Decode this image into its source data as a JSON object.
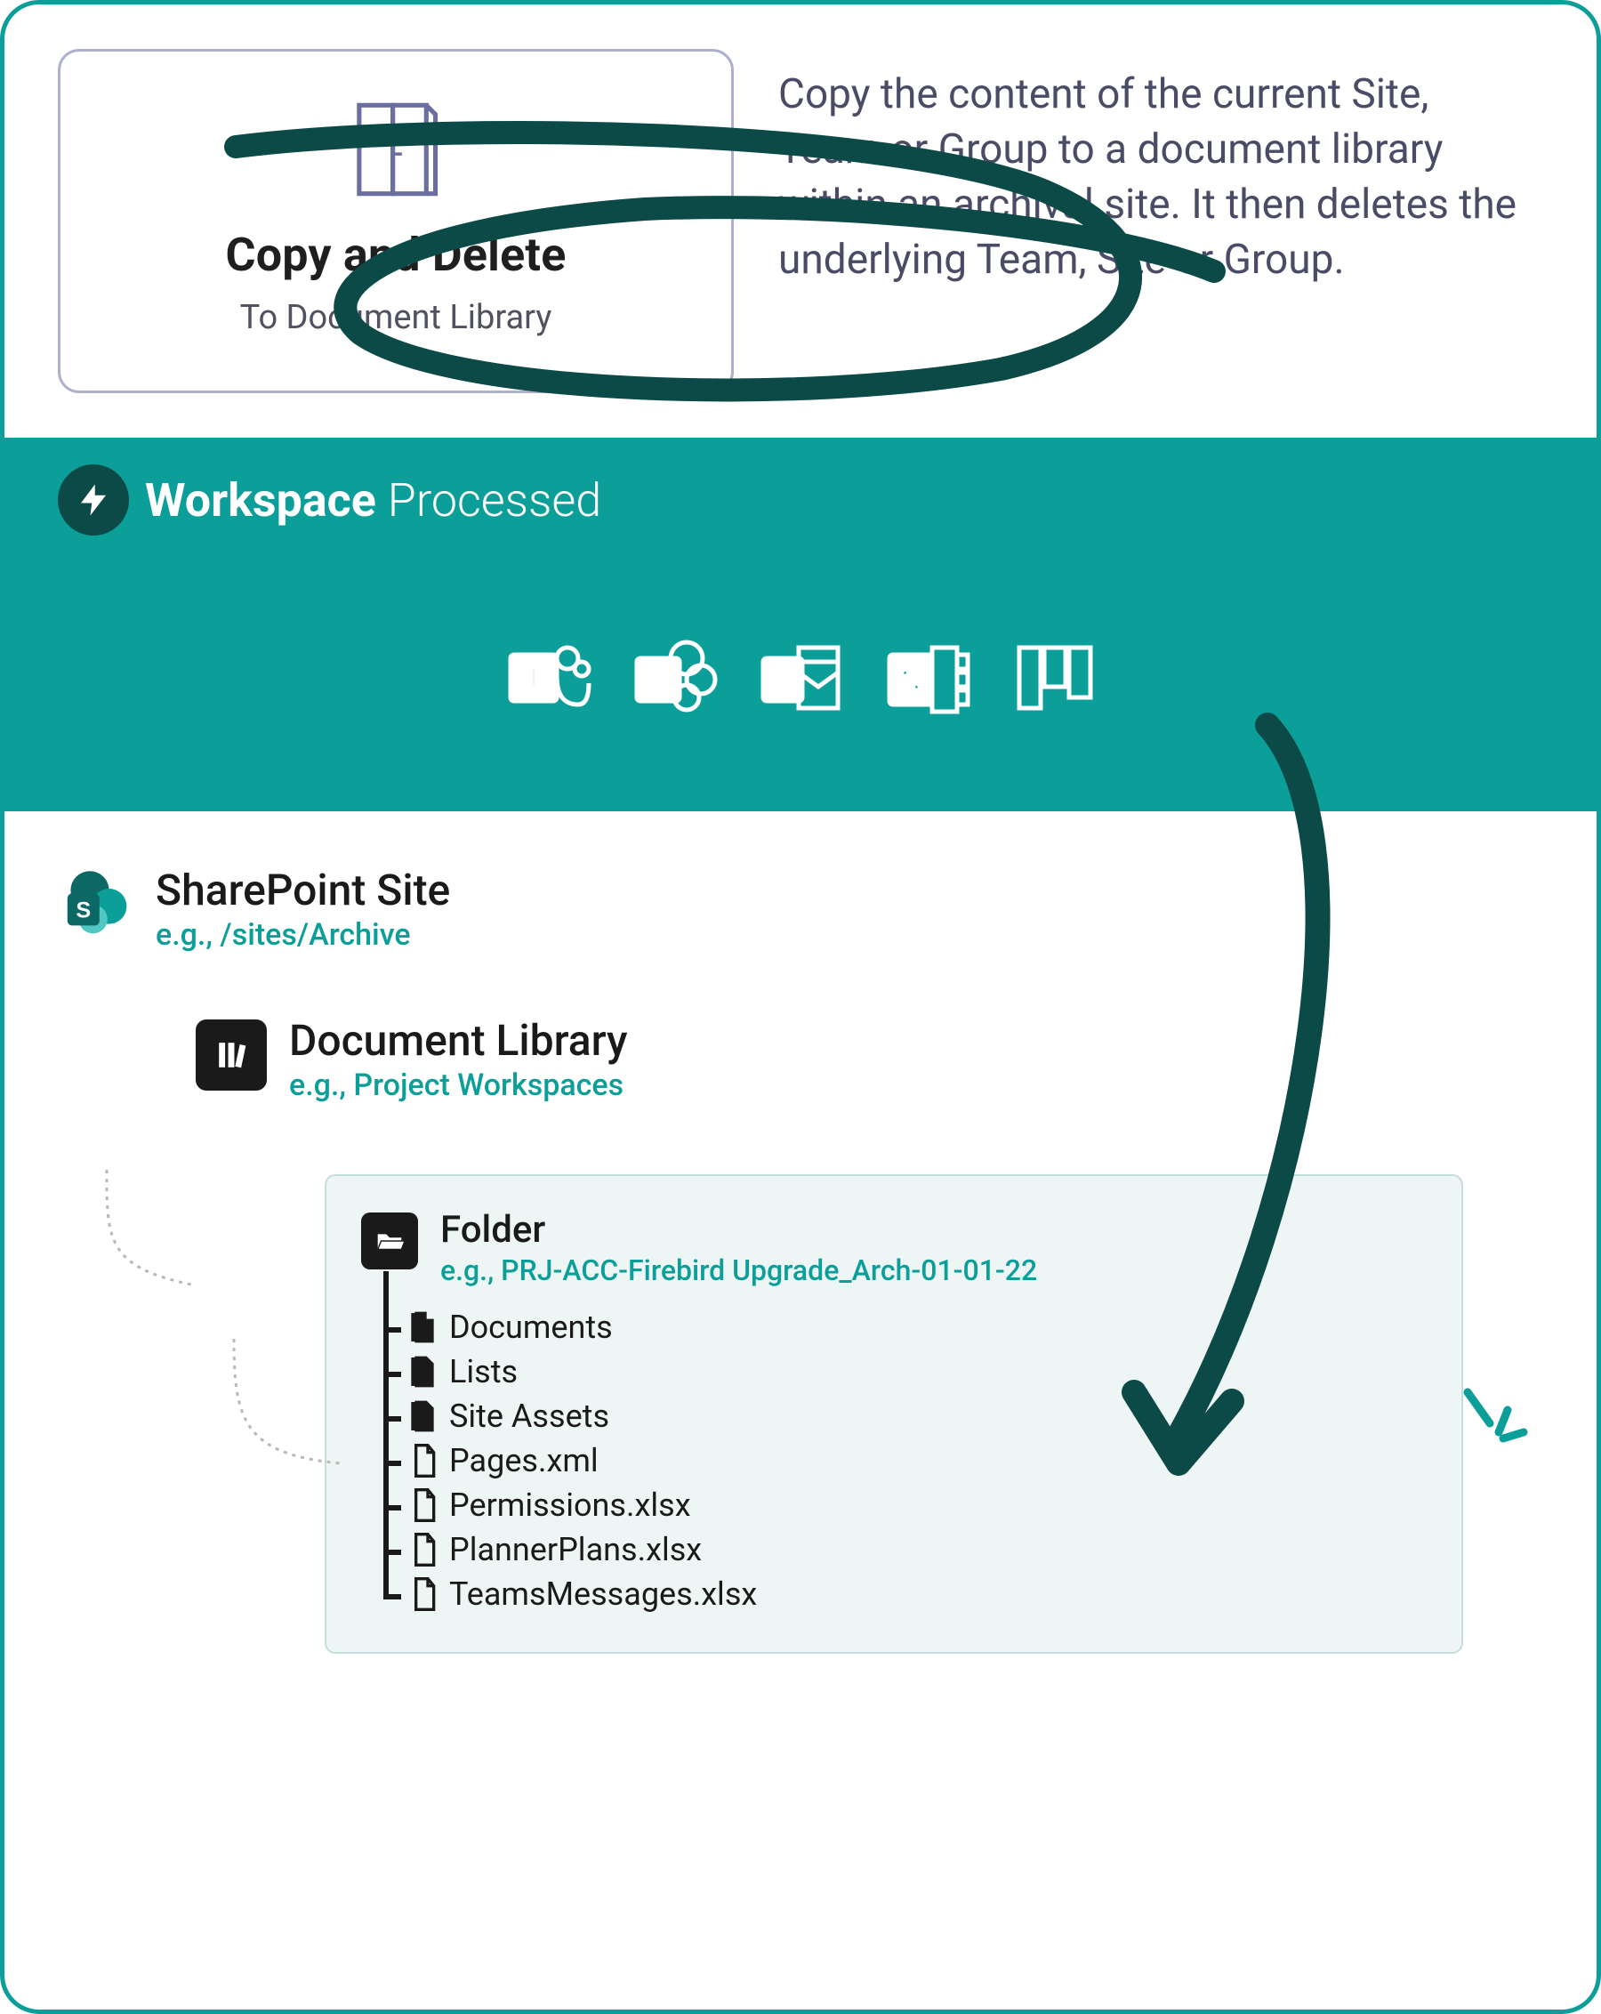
{
  "card": {
    "title": "Copy and Delete",
    "subtitle": "To Document Library"
  },
  "description": "Copy the content of the current Site, Team or Group to a document library within an archival site. It then deletes the underlying Team, Site or Group.",
  "banner": {
    "title_bold": "Workspace",
    "title_light": "Processed",
    "apps": [
      "teams-icon",
      "sharepoint-icon",
      "outlook-icon",
      "onenote-icon",
      "planner-icon"
    ]
  },
  "tree": {
    "site": {
      "title": "SharePoint Site",
      "example": "e.g., /sites/Archive"
    },
    "library": {
      "title": "Document Library",
      "example": "e.g., Project Workspaces"
    },
    "folder": {
      "title": "Folder",
      "example": "e.g., PRJ-ACC-Firebird Upgrade_Arch-01-01-22",
      "items": [
        {
          "type": "folder",
          "name": "Documents"
        },
        {
          "type": "folder",
          "name": "Lists"
        },
        {
          "type": "folder",
          "name": "Site Assets"
        },
        {
          "type": "file",
          "name": "Pages.xml"
        },
        {
          "type": "file",
          "name": "Permissions.xlsx"
        },
        {
          "type": "file",
          "name": "PlannerPlans.xlsx"
        },
        {
          "type": "file",
          "name": "TeamsMessages.xlsx"
        }
      ]
    }
  }
}
